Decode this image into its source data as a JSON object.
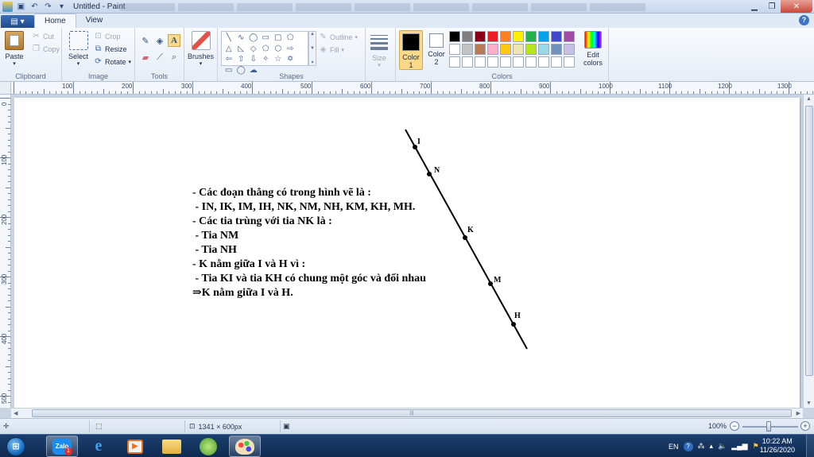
{
  "window": {
    "title": "Untitled - Paint"
  },
  "ribbon_tabs": {
    "file_label": "▤ ▾",
    "home": "Home",
    "view": "View"
  },
  "clipboard": {
    "paste": "Paste",
    "cut": "Cut",
    "copy": "Copy",
    "group": "Clipboard"
  },
  "image": {
    "select": "Select",
    "crop": "Crop",
    "resize": "Resize",
    "rotate": "Rotate",
    "group": "Image"
  },
  "tools": {
    "group": "Tools"
  },
  "brushes": {
    "label": "Brushes"
  },
  "shapes": {
    "outline": "Outline",
    "fill": "Fill",
    "group": "Shapes"
  },
  "size": {
    "label": "Size"
  },
  "colors": {
    "color1_label": "Color 1",
    "color2_label": "Color 2",
    "color1": "#000000",
    "color2": "#ffffff",
    "edit_colors": "Edit colors",
    "group": "Colors",
    "palette": [
      "#000000",
      "#7f7f7f",
      "#880015",
      "#ed1c24",
      "#ff7f27",
      "#fff200",
      "#22b14c",
      "#00a2e8",
      "#3f48cc",
      "#a349a4",
      "#ffffff",
      "#c3c3c3",
      "#b97a57",
      "#ffaec9",
      "#ffc90e",
      "#efe4b0",
      "#b5e61d",
      "#99d9ea",
      "#7092be",
      "#c8bfe7",
      "",
      "",
      "",
      "",
      "",
      "",
      "",
      "",
      "",
      ""
    ]
  },
  "ruler": {
    "h_labels": [
      "100",
      "200",
      "300",
      "400",
      "500",
      "600",
      "700",
      "800",
      "900",
      "1000",
      "1100",
      "1200",
      "1300"
    ],
    "v_labels": [
      "0",
      "100",
      "200",
      "300",
      "400",
      "500"
    ]
  },
  "drawing": {
    "lines": [
      "- Các đoạn thẳng có trong hình vẽ là :",
      " - IN, IK, IM, IH, NK, NM, NH, KM, KH, MH.",
      "- Các tia trùng với tia NK là :",
      " - Tia NM",
      " - Tia NH",
      "- K nằm giữa I và H vì :",
      " - Tia KI và tia KH có chung một góc và đối nhau",
      "⇒K nằm giữa I và H."
    ],
    "points": [
      "I",
      "N",
      "K",
      "M",
      "H"
    ]
  },
  "statusbar": {
    "image_size": "1341 × 600px",
    "zoom": "100%"
  },
  "taskbar": {
    "zalo_label": "Zalo",
    "zalo_badge": "1",
    "language": "EN",
    "time": "10:22 AM",
    "date": "11/26/2020"
  }
}
